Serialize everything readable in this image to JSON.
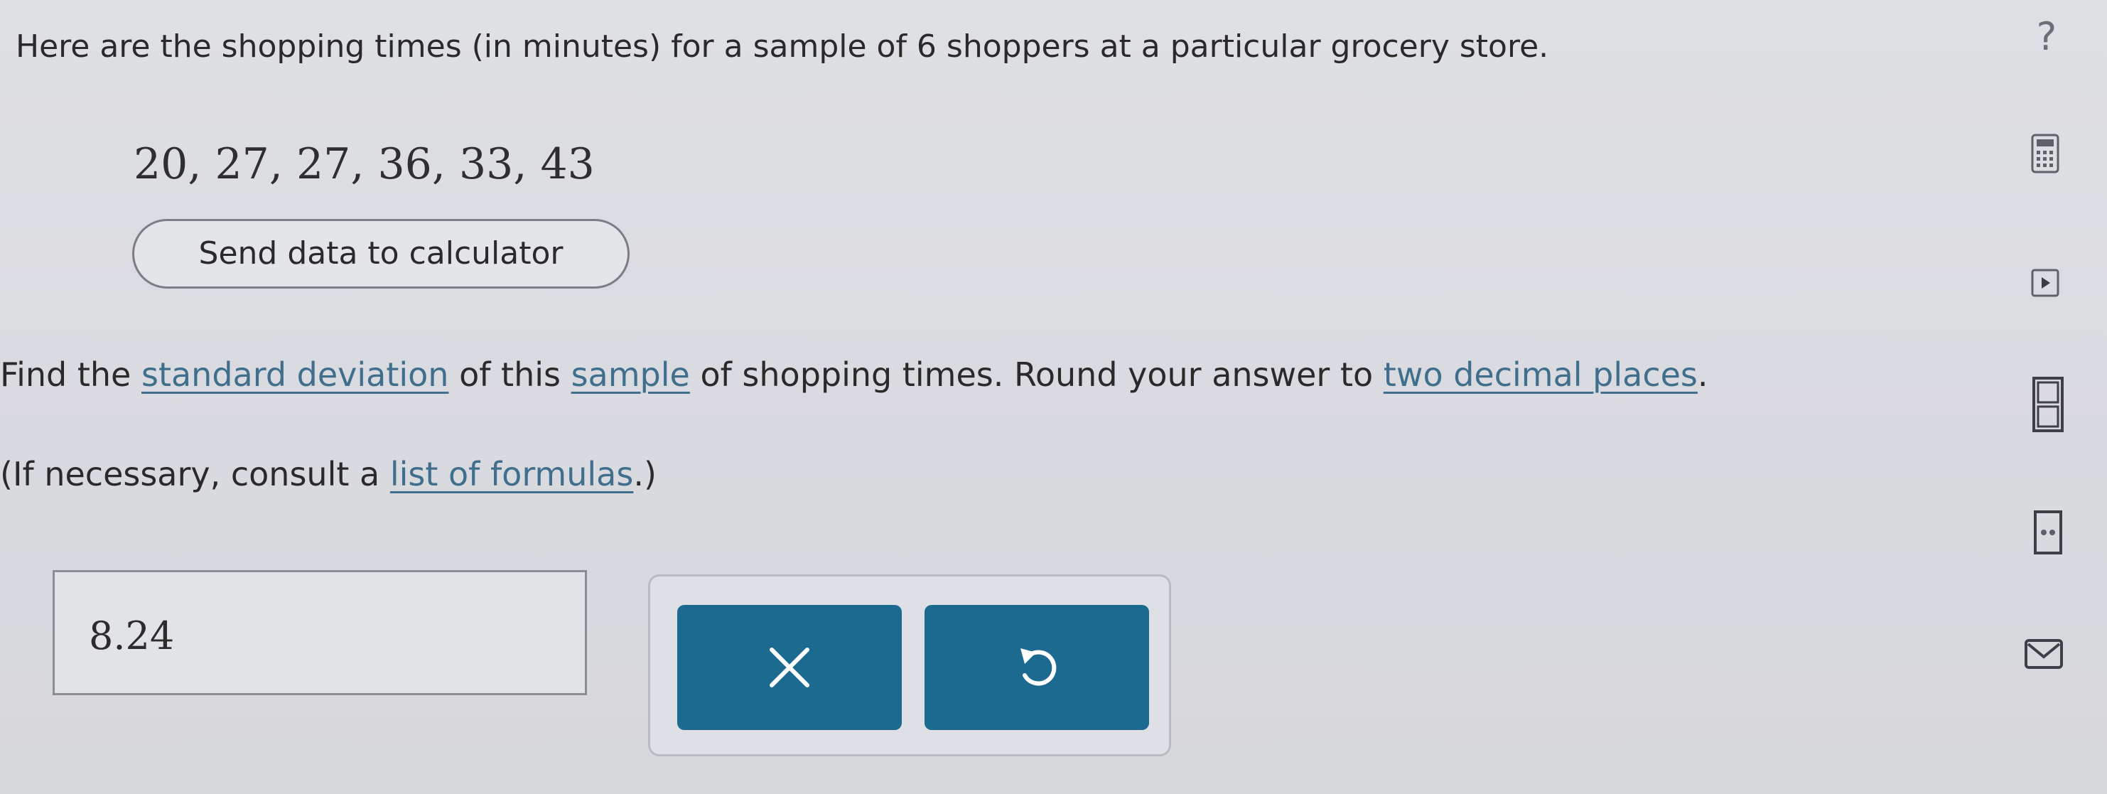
{
  "question": {
    "text": "Here are the shopping times (in minutes) for a sample of 6 shoppers at a particular grocery store.",
    "data_values": "20, 27, 27, 36, 33, 43"
  },
  "send_button": {
    "label": "Send data to calculator"
  },
  "prompt": {
    "find_part1": "Find the ",
    "find_link1": "standard deviation",
    "find_part2": " of this ",
    "find_link2": "sample",
    "find_part3": " of shopping times. Round your answer to ",
    "find_link3": "two decimal places",
    "find_part4": ".",
    "consult_part1": "(If necessary, consult a ",
    "consult_link": "list of formulas",
    "consult_part2": ".)"
  },
  "answer": {
    "value": "8.24"
  },
  "actions": {
    "clear_icon": "x-icon",
    "undo_icon": "undo-icon"
  },
  "help": {
    "symbol": "?"
  },
  "sidebar_icons": [
    "calculator-icon",
    "play-icon",
    "periodic-table-icon",
    "text-size-icon",
    "mail-icon"
  ],
  "colors": {
    "link": "#3f6f8d",
    "action_button": "#1c6a8f",
    "background": "#dcdde2"
  }
}
